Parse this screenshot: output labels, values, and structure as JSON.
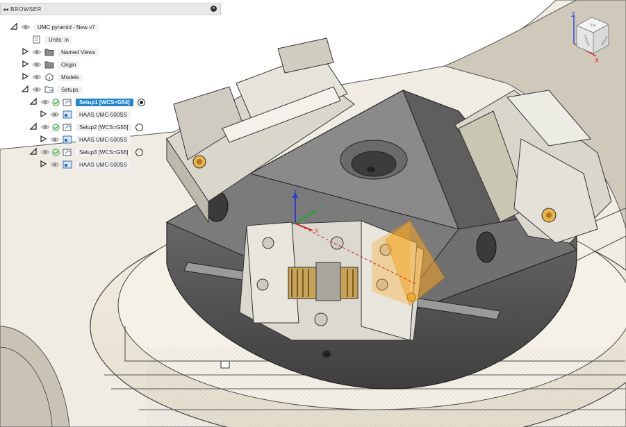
{
  "browser": {
    "title": "BROWSER",
    "items": [
      {
        "label": "UMC pyramid - New v7",
        "expand": "open",
        "icon": "eye-icon",
        "type": "document"
      },
      {
        "label": "Units: in",
        "expand": "none",
        "type": "units"
      },
      {
        "label": "Named Views",
        "expand": "closed",
        "type": "folder"
      },
      {
        "label": "Origin",
        "expand": "closed",
        "type": "folder"
      },
      {
        "label": "Models",
        "expand": "closed",
        "type": "models"
      },
      {
        "label": "Setups",
        "expand": "open",
        "type": "setups"
      },
      {
        "label": "Setup1 [WCS=G54]",
        "expand": "open",
        "selected": true,
        "active": true,
        "type": "setup"
      },
      {
        "label": "HAAS UMC-500SS",
        "expand": "closed",
        "type": "machine"
      },
      {
        "label": "Setup2 [WCS=G55]",
        "expand": "open",
        "active": false,
        "type": "setup"
      },
      {
        "label": "HAAS UMC-500SS",
        "expand": "closed",
        "type": "machine"
      },
      {
        "label": "Setup3 [WCS=G56]",
        "expand": "open",
        "active": false,
        "type": "setup"
      },
      {
        "label": "HAAS UMC-500SS",
        "expand": "closed",
        "type": "machine"
      }
    ]
  },
  "viewcube": {
    "faces": [
      "TOP",
      "FRONT",
      "RIGHT"
    ],
    "axes": [
      "Z",
      "X"
    ]
  },
  "triad": {
    "axes": [
      "Z",
      "Y",
      "X"
    ]
  },
  "colors": {
    "selection": "#1f85d4",
    "x_axis": "#e02020",
    "y_axis": "#1fa82a",
    "z_axis": "#2a3bd8",
    "stock_box": "#f5a623"
  }
}
